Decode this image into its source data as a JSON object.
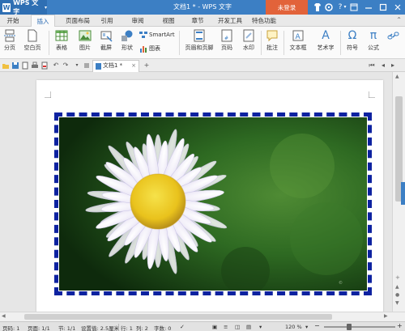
{
  "app": {
    "menu_label": "WPS 文字",
    "logo_glyph": "W",
    "window_title": "文档1 * - WPS 文字",
    "login_label": "未登录",
    "help_glyph": "?"
  },
  "tabs": [
    "开始",
    "插入",
    "页面布局",
    "引用",
    "审阅",
    "视图",
    "章节",
    "开发工具",
    "特色功能"
  ],
  "active_tab": "插入",
  "ribbon": {
    "page_break": "分页",
    "blank_page": "空白页",
    "table": "表格",
    "picture": "图片",
    "screenshot": "截屏",
    "shapes": "形状",
    "smartart": "SmartArt",
    "chart": "图表",
    "header_footer": "页眉和页脚",
    "page_number": "页码",
    "watermark": "水印",
    "comment": "批注",
    "textbox": "文本框",
    "wordart": "艺术字",
    "symbol": "符号",
    "formula": "公式",
    "omega_glyph": "Ω",
    "pi_glyph": "π",
    "wordart_glyph": "A"
  },
  "document_tab": {
    "label": "文档1 *",
    "close_glyph": "×"
  },
  "statusbar": {
    "page": "页码: 1",
    "pages": "页面: 1/1",
    "section": "节: 1/1",
    "position": "设置值: 2.5厘米",
    "row": "行: 1",
    "col": "列: 2",
    "words": "字数: 0",
    "zoom": "120 %",
    "minus": "−",
    "plus": "+"
  },
  "colors": {
    "accent": "#3c7fc4",
    "login": "#e2633a",
    "frame_border": "#0d22a0"
  }
}
